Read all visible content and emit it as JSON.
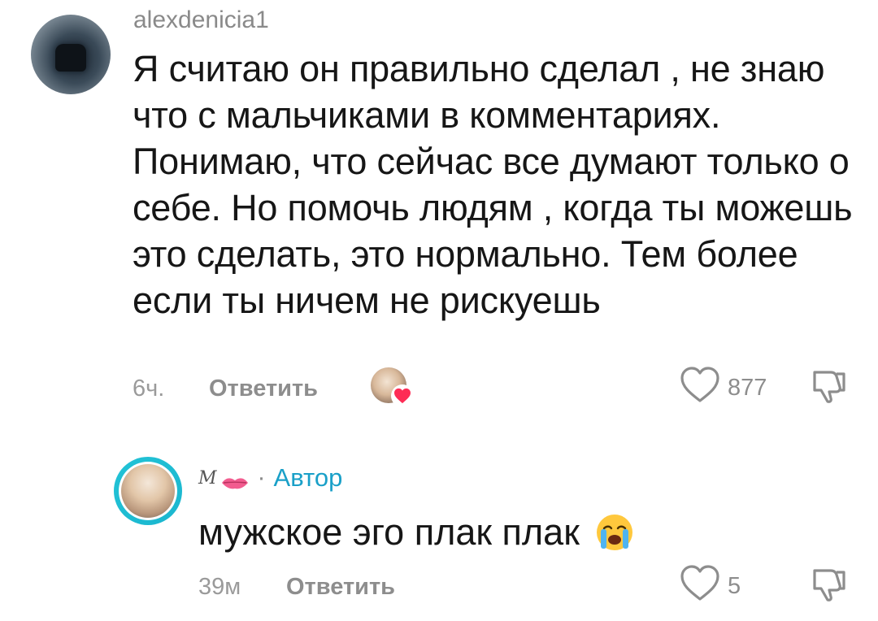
{
  "comments": [
    {
      "username": "alexdenicia1",
      "text": "Я считаю он правильно сделал , не знаю что с мальчиками в комментариях. Понимаю, что сейчас все думают только о себе. Но помочь людям , когда ты можешь это сделать, это нормально. Тем более если ты ничем не рискуешь",
      "time": "6ч.",
      "reply_label": "Ответить",
      "likes": "877",
      "liked_by_creator": true
    },
    {
      "author_name": "M",
      "author_badge": "Автор",
      "separator": "·",
      "text": "мужское эго плак плак",
      "time": "39м",
      "reply_label": "Ответить",
      "likes": "5"
    }
  ],
  "colors": {
    "accent_author": "#1aa0c8",
    "avatar_ring": "#22c3d6",
    "meta_text": "#8d8d8d",
    "heart": "#fe2c55"
  },
  "icons": {
    "like": "heart-outline-icon",
    "dislike": "thumbs-down-icon",
    "creator_liked": "heart-badge-icon",
    "emoji": "loudly-crying-face"
  }
}
